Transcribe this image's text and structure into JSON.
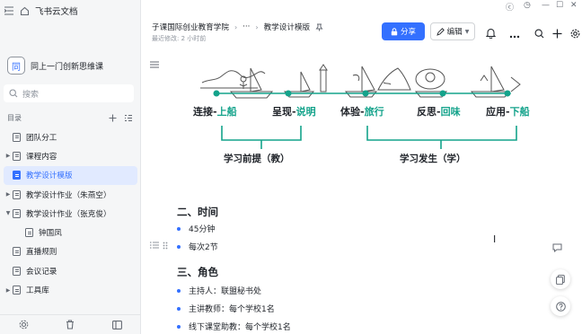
{
  "app": {
    "brand": "飞书云文档"
  },
  "space": {
    "logo_char": "同",
    "name": "同上一门创新思维课"
  },
  "search": {
    "placeholder": "搜索"
  },
  "toc": {
    "label": "目录"
  },
  "tree": [
    {
      "label": "团队分工",
      "arrow": "",
      "active": false,
      "child": false
    },
    {
      "label": "课程内容",
      "arrow": "▶",
      "active": false,
      "child": false
    },
    {
      "label": "教学设计模版",
      "arrow": "",
      "active": true,
      "child": false
    },
    {
      "label": "教学设计作业（朱燕空）",
      "arrow": "▶",
      "active": false,
      "child": false
    },
    {
      "label": "教学设计作业（张克俊）",
      "arrow": "▼",
      "active": false,
      "child": false
    },
    {
      "label": "钟国凤",
      "arrow": "",
      "active": false,
      "child": true
    },
    {
      "label": "直播规则",
      "arrow": "",
      "active": false,
      "child": false
    },
    {
      "label": "会议记录",
      "arrow": "",
      "active": false,
      "child": false
    },
    {
      "label": "工具库",
      "arrow": "▶",
      "active": false,
      "child": false
    }
  ],
  "header": {
    "breadcrumb": [
      "子课国际创业教育学院",
      "···",
      "教学设计模版"
    ],
    "edited": "最近修改: 2 小时前",
    "share": "分享",
    "edit": "编辑"
  },
  "diagram": {
    "stages": [
      {
        "a": "连接",
        "b": "上船"
      },
      {
        "a": "呈现",
        "b": "说明"
      },
      {
        "a": "体验",
        "b": "旅行"
      },
      {
        "a": "反思",
        "b": "回味"
      },
      {
        "a": "应用",
        "b": "下船"
      }
    ],
    "group_left": "学习前提（教）",
    "group_right": "学习发生（学）",
    "accent": "#14a38b"
  },
  "sections": [
    {
      "title": "二、时间",
      "items": [
        "45分钟",
        "每次2节"
      ]
    },
    {
      "title": "三、角色",
      "items": [
        "主持人：联盟秘书处",
        "主讲教师：每个学校1名",
        "线下课堂助教：每个学校1名"
      ]
    }
  ],
  "colors": {
    "primary": "#3370ff",
    "sidebar": "#f5f6f7"
  }
}
